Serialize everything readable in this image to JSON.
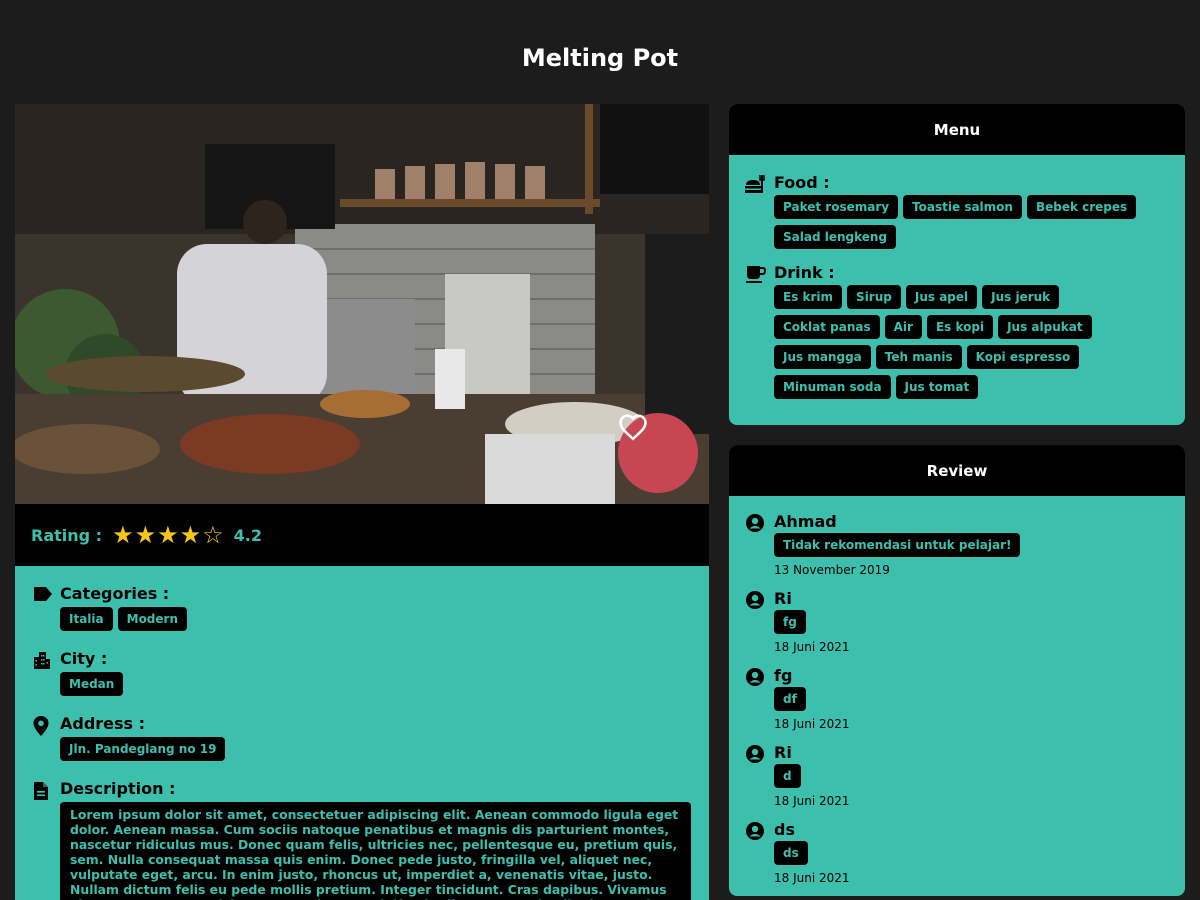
{
  "page": {
    "title": "Melting Pot"
  },
  "rating": {
    "label": "Rating :",
    "value": "4.2",
    "stars": 4.2,
    "max_stars": 5
  },
  "info": {
    "categories": {
      "label": "Categories :",
      "items": [
        "Italia",
        "Modern"
      ]
    },
    "city": {
      "label": "City :",
      "value": "Medan"
    },
    "address": {
      "label": "Address :",
      "value": "Jln. Pandeglang no 19"
    },
    "description": {
      "label": "Description :",
      "text": "Lorem ipsum dolor sit amet, consectetuer adipiscing elit. Aenean commodo ligula eget dolor. Aenean massa. Cum sociis natoque penatibus et magnis dis parturient montes, nascetur ridiculus mus. Donec quam felis, ultricies nec, pellentesque eu, pretium quis, sem. Nulla consequat massa quis enim. Donec pede justo, fringilla vel, aliquet nec, vulputate eget, arcu. In enim justo, rhoncus ut, imperdiet a, venenatis vitae, justo. Nullam dictum felis eu pede mollis pretium. Integer tincidunt. Cras dapibus. Vivamus elementum semper nisi. Aenean vulputate eleifend tellus. Aenean leo ligula, porttitor eu, consequat vitae, eleifend ac, enim. Aliquam lorem ante, dapibus in"
    }
  },
  "menu": {
    "title": "Menu",
    "food": {
      "label": "Food :",
      "items": [
        "Paket rosemary",
        "Toastie salmon",
        "Bebek crepes",
        "Salad lengkeng"
      ]
    },
    "drink": {
      "label": "Drink :",
      "items": [
        "Es krim",
        "Sirup",
        "Jus apel",
        "Jus jeruk",
        "Coklat panas",
        "Air",
        "Es kopi",
        "Jus alpukat",
        "Jus mangga",
        "Teh manis",
        "Kopi espresso",
        "Minuman soda",
        "Jus tomat"
      ]
    }
  },
  "reviews": {
    "title": "Review",
    "items": [
      {
        "name": "Ahmad",
        "text": "Tidak rekomendasi untuk pelajar!",
        "date": "13 November 2019"
      },
      {
        "name": "Ri",
        "text": "fg",
        "date": "18 Juni 2021"
      },
      {
        "name": "fg",
        "text": "df",
        "date": "18 Juni 2021"
      },
      {
        "name": "Ri",
        "text": "d",
        "date": "18 Juni 2021"
      },
      {
        "name": "ds",
        "text": "ds",
        "date": "18 Juni 2021"
      }
    ]
  },
  "colors": {
    "accent": "#3dbfad",
    "panel_header": "#000000",
    "background": "#1c1c1c",
    "favorite": "#c84652",
    "star": "#f5c518"
  },
  "icons": {
    "favorite": "heart-icon",
    "categories": "tag-icon",
    "city": "city-icon",
    "address": "location-pin-icon",
    "description": "document-icon",
    "food": "food-icon",
    "drink": "cup-icon",
    "reviewer": "user-circle-icon"
  }
}
